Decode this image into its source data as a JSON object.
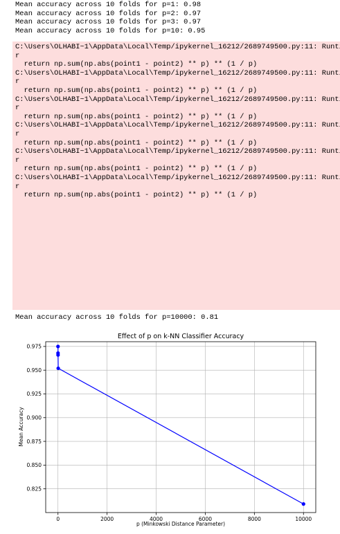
{
  "output_top": [
    "Mean accuracy across 10 folds for p=1: 0.98",
    "Mean accuracy across 10 folds for p=2: 0.97",
    "Mean accuracy across 10 folds for p=3: 0.97",
    "Mean accuracy across 10 folds for p=10: 0.95"
  ],
  "warning": {
    "path_line": "C:\\Users\\OLHABI~1\\AppData\\Local\\Temp/ipykernel_16212/2689749500.py:11: Runti",
    "wrap_line": "r",
    "code_line": "  return np.sum(np.abs(point1 - point2) ** p) ** (1 / p)",
    "repeat": 6
  },
  "output_bottom": "Mean accuracy across 10 folds for p=10000: 0.81",
  "colors": {
    "warning_bg": "#fddddd",
    "line": "#0000ff",
    "grid": "#b0b0b0"
  },
  "chart_data": {
    "type": "line",
    "title": "Effect of p on k-NN Classifier Accuracy",
    "xlabel": "p (Minkowski Distance Parameter)",
    "ylabel": "Mean Accuracy",
    "x": [
      1,
      2,
      3,
      10,
      10000
    ],
    "y": [
      0.975,
      0.968,
      0.966,
      0.952,
      0.809
    ],
    "xlim": [
      -500,
      10500
    ],
    "ylim": [
      0.8,
      0.98
    ],
    "xticks": [
      0,
      2000,
      4000,
      6000,
      8000,
      10000
    ],
    "yticks": [
      0.825,
      0.85,
      0.875,
      0.9,
      0.925,
      0.95,
      0.975
    ],
    "ytick_labels": [
      "0.825",
      "0.850",
      "0.875",
      "0.900",
      "0.925",
      "0.950",
      "0.975"
    ],
    "grid": true,
    "marker": "circle"
  }
}
